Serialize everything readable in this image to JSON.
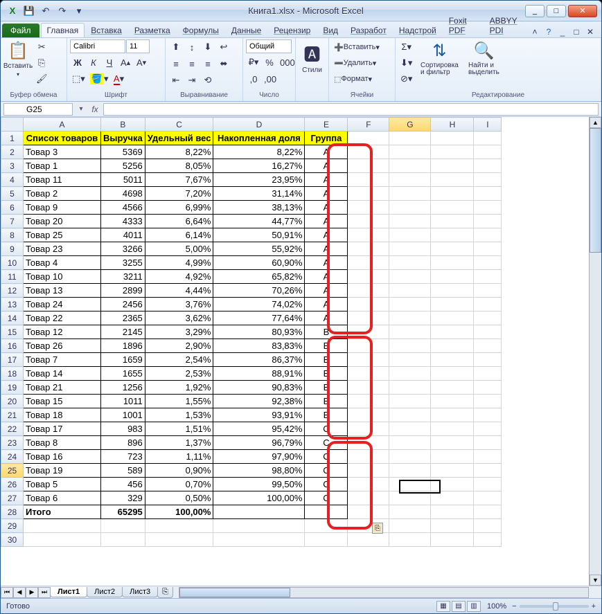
{
  "window": {
    "title": "Книга1.xlsx - Microsoft Excel"
  },
  "qat": {
    "save": "💾",
    "undo": "↶",
    "redo": "↷",
    "menu": "▾"
  },
  "win_controls": {
    "min": "_",
    "max": "□",
    "close": "✕"
  },
  "tabs": {
    "file": "Файл",
    "items": [
      "Главная",
      "Вставка",
      "Разметка",
      "Формулы",
      "Данные",
      "Рецензир",
      "Вид",
      "Разработ",
      "Надстрой",
      "Foxit PDF",
      "ABBYY PDI"
    ],
    "active": 0
  },
  "ribbon": {
    "clipboard": {
      "label": "Буфер обмена",
      "paste": "Вставить"
    },
    "font": {
      "label": "Шрифт",
      "name": "Calibri",
      "size": "11"
    },
    "align": {
      "label": "Выравнивание"
    },
    "number": {
      "label": "Число",
      "format": "Общий"
    },
    "styles": {
      "label": "Стили",
      "btn": "Стили"
    },
    "cells": {
      "label": "Ячейки",
      "insert": "Вставить",
      "delete": "Удалить",
      "format": "Формат"
    },
    "editing": {
      "label": "Редактирование",
      "sort": "Сортировка\nи фильтр",
      "find": "Найти и\nвыделить"
    }
  },
  "formula_bar": {
    "name_box": "G25",
    "fx": "fx"
  },
  "columns": [
    "A",
    "B",
    "C",
    "D",
    "E",
    "F",
    "G",
    "H",
    "I"
  ],
  "headers": [
    "Список товаров",
    "Выручка",
    "Удельный вес",
    "Накопленная доля",
    "Группа"
  ],
  "rows": [
    {
      "n": 2,
      "a": "Товар 3",
      "b": "5369",
      "c": "8,22%",
      "d": "8,22%",
      "e": "A"
    },
    {
      "n": 3,
      "a": "Товар 1",
      "b": "5256",
      "c": "8,05%",
      "d": "16,27%",
      "e": "A"
    },
    {
      "n": 4,
      "a": "Товар 11",
      "b": "5011",
      "c": "7,67%",
      "d": "23,95%",
      "e": "A"
    },
    {
      "n": 5,
      "a": "Товар 2",
      "b": "4698",
      "c": "7,20%",
      "d": "31,14%",
      "e": "A"
    },
    {
      "n": 6,
      "a": "Товар 9",
      "b": "4566",
      "c": "6,99%",
      "d": "38,13%",
      "e": "A"
    },
    {
      "n": 7,
      "a": "Товар 20",
      "b": "4333",
      "c": "6,64%",
      "d": "44,77%",
      "e": "A"
    },
    {
      "n": 8,
      "a": "Товар 25",
      "b": "4011",
      "c": "6,14%",
      "d": "50,91%",
      "e": "A"
    },
    {
      "n": 9,
      "a": "Товар 23",
      "b": "3266",
      "c": "5,00%",
      "d": "55,92%",
      "e": "A"
    },
    {
      "n": 10,
      "a": "Товар 4",
      "b": "3255",
      "c": "4,99%",
      "d": "60,90%",
      "e": "A"
    },
    {
      "n": 11,
      "a": "Товар 10",
      "b": "3211",
      "c": "4,92%",
      "d": "65,82%",
      "e": "A"
    },
    {
      "n": 12,
      "a": "Товар 13",
      "b": "2899",
      "c": "4,44%",
      "d": "70,26%",
      "e": "A"
    },
    {
      "n": 13,
      "a": "Товар 24",
      "b": "2456",
      "c": "3,76%",
      "d": "74,02%",
      "e": "A"
    },
    {
      "n": 14,
      "a": "Товар 22",
      "b": "2365",
      "c": "3,62%",
      "d": "77,64%",
      "e": "A"
    },
    {
      "n": 15,
      "a": "Товар 12",
      "b": "2145",
      "c": "3,29%",
      "d": "80,93%",
      "e": "B"
    },
    {
      "n": 16,
      "a": "Товар 26",
      "b": "1896",
      "c": "2,90%",
      "d": "83,83%",
      "e": "B"
    },
    {
      "n": 17,
      "a": "Товар 7",
      "b": "1659",
      "c": "2,54%",
      "d": "86,37%",
      "e": "B"
    },
    {
      "n": 18,
      "a": "Товар 14",
      "b": "1655",
      "c": "2,53%",
      "d": "88,91%",
      "e": "B"
    },
    {
      "n": 19,
      "a": "Товар 21",
      "b": "1256",
      "c": "1,92%",
      "d": "90,83%",
      "e": "B"
    },
    {
      "n": 20,
      "a": "Товар 15",
      "b": "1011",
      "c": "1,55%",
      "d": "92,38%",
      "e": "B"
    },
    {
      "n": 21,
      "a": "Товар 18",
      "b": "1001",
      "c": "1,53%",
      "d": "93,91%",
      "e": "B"
    },
    {
      "n": 22,
      "a": "Товар 17",
      "b": "983",
      "c": "1,51%",
      "d": "95,42%",
      "e": "C"
    },
    {
      "n": 23,
      "a": "Товар 8",
      "b": "896",
      "c": "1,37%",
      "d": "96,79%",
      "e": "C"
    },
    {
      "n": 24,
      "a": "Товар 16",
      "b": "723",
      "c": "1,11%",
      "d": "97,90%",
      "e": "C"
    },
    {
      "n": 25,
      "a": "Товар 19",
      "b": "589",
      "c": "0,90%",
      "d": "98,80%",
      "e": "C"
    },
    {
      "n": 26,
      "a": "Товар 5",
      "b": "456",
      "c": "0,70%",
      "d": "99,50%",
      "e": "C"
    },
    {
      "n": 27,
      "a": "Товар 6",
      "b": "329",
      "c": "0,50%",
      "d": "100,00%",
      "e": "C"
    }
  ],
  "total_row": {
    "n": 28,
    "a": "Итого",
    "b": "65295",
    "c": "100,00%"
  },
  "empty_rows": [
    29,
    30
  ],
  "sheets": {
    "items": [
      "Лист1",
      "Лист2",
      "Лист3"
    ],
    "active": 0
  },
  "status": {
    "ready": "Готово",
    "zoom": "100%"
  },
  "active_cell": "G25"
}
